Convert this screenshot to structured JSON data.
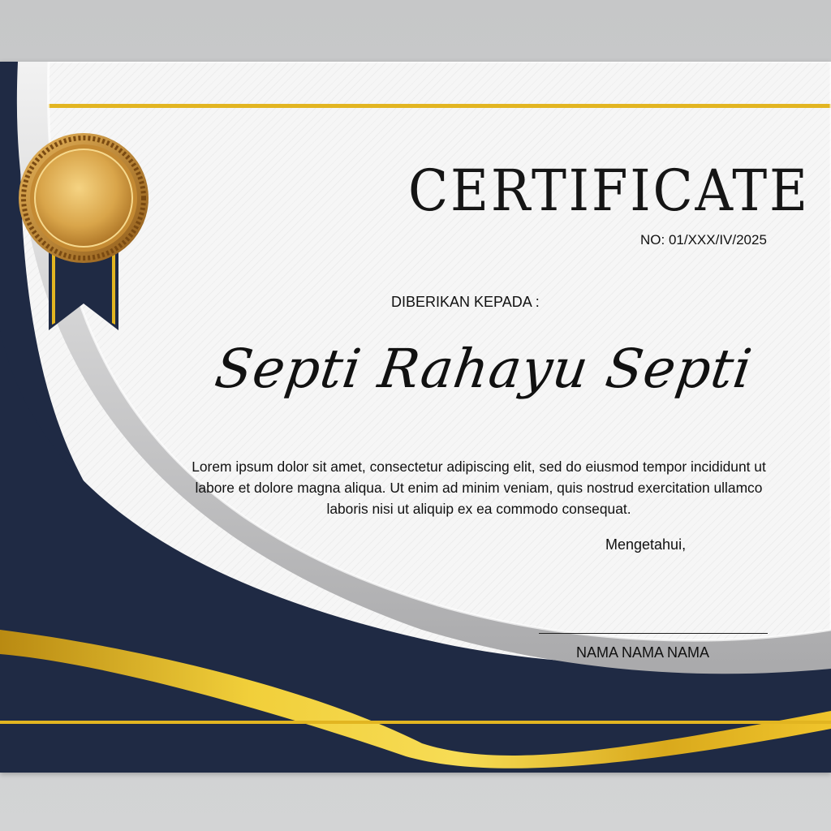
{
  "certificate": {
    "title": "CERTIFICATE",
    "number": "NO: 01/XXX/IV/2025",
    "given_to_label": "DIBERIKAN KEPADA :",
    "recipient_name": "Septi Rahayu Septi",
    "body": "Lorem ipsum dolor sit amet, consectetur adipiscing elit, sed do eiusmod tempor incididunt ut labore et dolore magna aliqua. Ut enim ad minim veniam, quis nostrud exercitation ullamco laboris nisi ut aliquip ex ea commodo consequat.",
    "acknowledged_label": "Mengetahui,",
    "signer_name": "NAMA NAMA NAMA"
  },
  "icons": {
    "medal": "gold-medal-icon"
  },
  "colors": {
    "navy": "#1f2a44",
    "gold": "#e2b521",
    "silver": "#c4c4c6",
    "paper": "#f6f6f6"
  }
}
